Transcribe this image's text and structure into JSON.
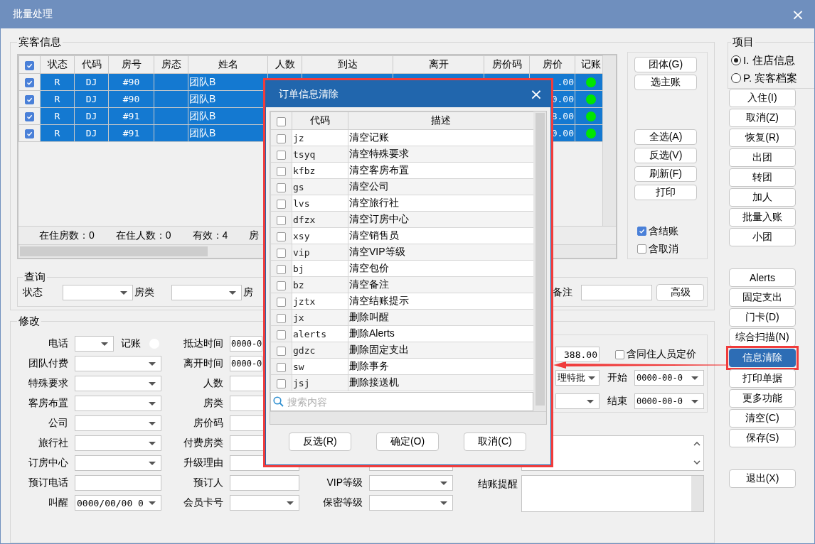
{
  "window": {
    "title": "批量处理",
    "close": "×"
  },
  "guest_info": {
    "title": "宾客信息",
    "table": {
      "all_checked": true,
      "columns": [
        "状态",
        "代码",
        "房号",
        "房态",
        "姓名",
        "人数",
        "到达",
        "离开",
        "房价码",
        "房价",
        "记账"
      ],
      "rows": [
        {
          "checked": true,
          "selected": true,
          "status": "R",
          "code": "DJ",
          "room": "#90",
          "name": "团队B",
          "rate": ".00",
          "posted": true
        },
        {
          "checked": true,
          "selected": true,
          "status": "R",
          "code": "DJ",
          "room": "#90",
          "name": "团队B",
          "rate": "0.00",
          "posted": true
        },
        {
          "checked": true,
          "selected": true,
          "status": "R",
          "code": "DJ",
          "room": "#91",
          "name": "团队B",
          "rate": "8.00",
          "posted": true
        },
        {
          "checked": true,
          "selected": true,
          "status": "R",
          "code": "DJ",
          "room": "#91",
          "name": "团队B",
          "rate": "0.00",
          "posted": true
        }
      ],
      "stats": [
        "在住房数：0",
        "在住人数：0",
        "有效：4",
        "房"
      ]
    },
    "button_groups": [
      [
        "团体(G)",
        "选主账"
      ],
      [
        "全选(A)",
        "反选(V)",
        "刷新(F)",
        "打印"
      ]
    ],
    "options": [
      {
        "label": "含结账",
        "checked": true
      },
      {
        "label": "含取消",
        "checked": false
      }
    ],
    "query": {
      "title": "查询",
      "left": [
        {
          "label": "状态",
          "kind": "select"
        },
        {
          "label": "房类",
          "kind": "select"
        },
        {
          "label": "房",
          "kind": "label"
        }
      ],
      "right": [
        {
          "label": "备注",
          "kind": "input"
        }
      ],
      "button": "高级"
    }
  },
  "modify": {
    "title": "修改",
    "col1": [
      {
        "label": "电话",
        "kind": "select",
        "narrow": true,
        "extra": {
          "label": "记账",
          "on": false
        }
      },
      {
        "label": "团队付费",
        "kind": "select"
      },
      {
        "label": "特殊要求",
        "kind": "select"
      },
      {
        "label": "客房布置",
        "kind": "select"
      },
      {
        "label": "公司",
        "kind": "select"
      },
      {
        "label": "旅行社",
        "kind": "select"
      },
      {
        "label": "订房中心",
        "kind": "select"
      },
      {
        "label": "预订电话",
        "kind": "input"
      },
      {
        "label": "叫醒",
        "kind": "select",
        "value": "0000/00/00 0"
      }
    ],
    "col2": [
      {
        "label": "抵达时间",
        "kind": "input",
        "narrow": true,
        "value": "0000-0"
      },
      {
        "label": "离开时间",
        "kind": "input",
        "narrow": true,
        "value": "0000-0"
      },
      {
        "label": "人数",
        "kind": "input"
      },
      {
        "label": "房类",
        "kind": "input"
      },
      {
        "label": "房价码",
        "kind": "input"
      },
      {
        "label": "付费房类",
        "kind": "input"
      },
      {
        "label": "升级理由",
        "kind": "input"
      },
      {
        "label": "预订人",
        "kind": "input"
      },
      {
        "label": "会员卡号",
        "kind": "select"
      }
    ],
    "col3": [
      {
        "kind": "input"
      },
      {
        "label": "VIP等级",
        "kind": "select"
      },
      {
        "label": "保密等级",
        "kind": "select"
      }
    ],
    "pricing": {
      "rate": "388.00",
      "share": {
        "label": "含同住人员定价",
        "checked": false
      },
      "rows": [
        {
          "value": "理特批",
          "label": "开始",
          "date": "0000-00-0"
        },
        {
          "label": "结束",
          "date": "0000-00-0"
        }
      ]
    },
    "reminder": {
      "label": "结账提醒"
    }
  },
  "side": {
    "items_group": {
      "title": "项目",
      "options": [
        {
          "label": "I. 住店信息",
          "selected": true
        },
        {
          "label": "P. 宾客档案",
          "selected": false
        }
      ]
    },
    "groups": [
      [
        {
          "label": "入住(I)",
          "selected": false
        },
        {
          "label": "取消(Z)",
          "selected": false
        },
        {
          "label": "恢复(R)",
          "selected": false
        },
        {
          "label": "出团",
          "selected": false
        },
        {
          "label": "转团",
          "selected": false
        },
        {
          "label": "加人",
          "selected": false
        },
        {
          "label": "批量入账",
          "selected": false
        },
        {
          "label": "小团",
          "selected": false
        }
      ],
      [
        {
          "label": "Alerts",
          "selected": false
        },
        {
          "label": "固定支出",
          "selected": false
        },
        {
          "label": "门卡(D)",
          "selected": false
        },
        {
          "label": "综合扫描(N)",
          "selected": false
        },
        {
          "label": "信息清除",
          "selected": true
        },
        {
          "label": "打印单据",
          "selected": false
        },
        {
          "label": "更多功能",
          "selected": false
        },
        {
          "label": "清空(C)",
          "selected": false
        },
        {
          "label": "保存(S)",
          "selected": false
        }
      ],
      [
        {
          "label": "退出(X)",
          "selected": false
        }
      ]
    ]
  },
  "dialog": {
    "title": "订单信息清除",
    "close": "×",
    "all_checked": false,
    "columns": [
      "代码",
      "描述"
    ],
    "items": [
      {
        "code": "jz",
        "text": "清空记账",
        "checked": false
      },
      {
        "code": "tsyq",
        "text": "清空特殊要求",
        "checked": false
      },
      {
        "code": "kfbz",
        "text": "清空客房布置",
        "checked": false
      },
      {
        "code": "gs",
        "text": "清空公司",
        "checked": false
      },
      {
        "code": "lvs",
        "text": "清空旅行社",
        "checked": false
      },
      {
        "code": "dfzx",
        "text": "清空订房中心",
        "checked": false
      },
      {
        "code": "xsy",
        "text": "清空销售员",
        "checked": false
      },
      {
        "code": "vip",
        "text": "清空VIP等级",
        "checked": false
      },
      {
        "code": "bj",
        "text": "清空包价",
        "checked": false
      },
      {
        "code": "bz",
        "text": "清空备注",
        "checked": false
      },
      {
        "code": "jztx",
        "text": "清空结账提示",
        "checked": false
      },
      {
        "code": "jx",
        "text": "删除叫醒",
        "checked": false
      },
      {
        "code": "alerts",
        "text": "删除Alerts",
        "checked": false
      },
      {
        "code": "gdzc",
        "text": "删除固定支出",
        "checked": false
      },
      {
        "code": "sw",
        "text": "删除事务",
        "checked": false
      },
      {
        "code": "jsj",
        "text": "删除接送机",
        "checked": false
      }
    ],
    "search": {
      "placeholder": "搜索内容"
    },
    "buttons": [
      "反选(R)",
      "确定(O)",
      "取消(C)"
    ]
  }
}
